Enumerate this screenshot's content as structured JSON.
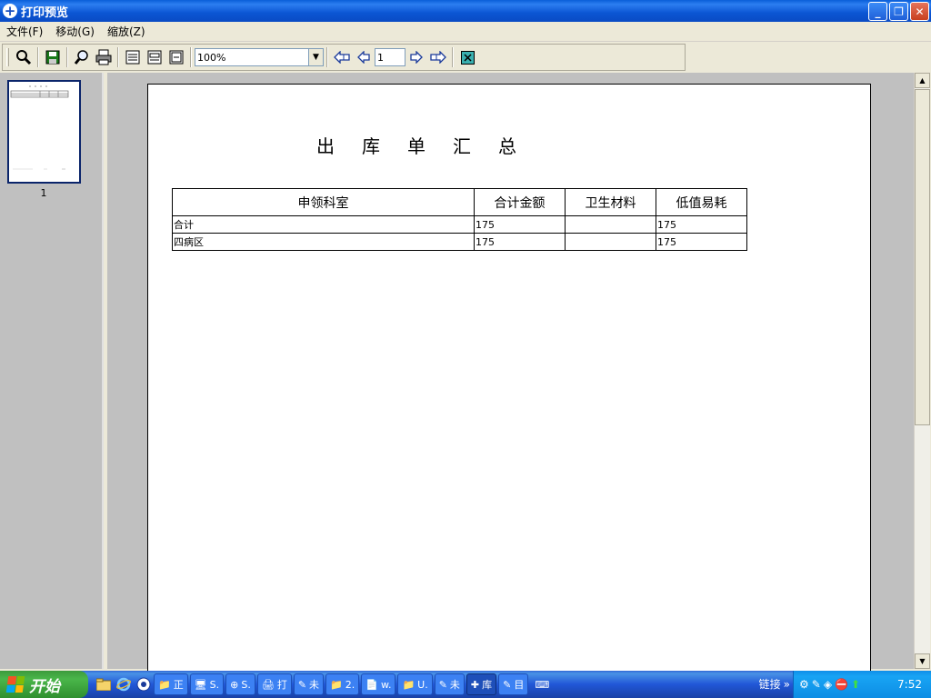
{
  "window": {
    "title": "打印预览",
    "app_icon": "+",
    "buttons": {
      "minimize": "_",
      "restore": "❐",
      "close": "✕"
    }
  },
  "menu": {
    "items": [
      "文件(F)",
      "移动(G)",
      "缩放(Z)"
    ]
  },
  "toolbar": {
    "zoom_value": "100%",
    "page_value": "1",
    "icons": [
      "magnifier-icon",
      "save-icon",
      "search-icon",
      "print-icon",
      "one-page-icon",
      "two-page-icon",
      "multi-page-icon",
      "first-page-icon",
      "prev-page-icon",
      "next-page-icon",
      "last-page-icon",
      "close-preview-icon"
    ]
  },
  "thumbnails": {
    "page_label": "1"
  },
  "report": {
    "title": "出库单汇总",
    "columns": [
      "申领科室",
      "合计金额",
      "卫生材料",
      "低值易耗"
    ],
    "rows": [
      {
        "department": "合计",
        "total": "175",
        "hygiene": "",
        "low_value": "175"
      },
      {
        "department": "四病区",
        "total": "175",
        "hygiene": "",
        "low_value": "175"
      }
    ]
  },
  "taskbar": {
    "start_label": "开始",
    "tasks": [
      {
        "icon": "folder-icon",
        "label": "正"
      },
      {
        "icon": "app-icon",
        "label": "S."
      },
      {
        "icon": "app-icon",
        "label": "S."
      },
      {
        "icon": "app-icon",
        "label": "打"
      },
      {
        "icon": "paint-icon",
        "label": "未"
      },
      {
        "icon": "folder-icon",
        "label": "2."
      },
      {
        "icon": "doc-icon",
        "label": "w."
      },
      {
        "icon": "folder-icon",
        "label": "U."
      },
      {
        "icon": "paint-icon",
        "label": "未"
      },
      {
        "icon": "app-plus-icon",
        "label": "库",
        "active": true
      },
      {
        "icon": "paint-icon",
        "label": "目"
      },
      {
        "icon": "keyboard-icon",
        "label": ""
      }
    ],
    "links_label": "链接",
    "clock": "7:52"
  },
  "colors": {
    "titlebar": "#0a5fd8",
    "taskbar": "#2157d7",
    "start": "#3c9a3c",
    "preview_bg": "#c0c0c0"
  }
}
